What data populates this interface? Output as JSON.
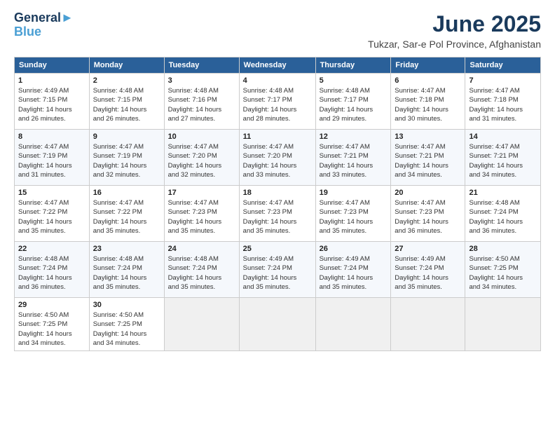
{
  "header": {
    "logo_line1": "General",
    "logo_line2": "Blue",
    "month": "June 2025",
    "location": "Tukzar, Sar-e Pol Province, Afghanistan"
  },
  "weekdays": [
    "Sunday",
    "Monday",
    "Tuesday",
    "Wednesday",
    "Thursday",
    "Friday",
    "Saturday"
  ],
  "weeks": [
    [
      {
        "day": "1",
        "info": "Sunrise: 4:49 AM\nSunset: 7:15 PM\nDaylight: 14 hours\nand 26 minutes."
      },
      {
        "day": "2",
        "info": "Sunrise: 4:48 AM\nSunset: 7:15 PM\nDaylight: 14 hours\nand 26 minutes."
      },
      {
        "day": "3",
        "info": "Sunrise: 4:48 AM\nSunset: 7:16 PM\nDaylight: 14 hours\nand 27 minutes."
      },
      {
        "day": "4",
        "info": "Sunrise: 4:48 AM\nSunset: 7:17 PM\nDaylight: 14 hours\nand 28 minutes."
      },
      {
        "day": "5",
        "info": "Sunrise: 4:48 AM\nSunset: 7:17 PM\nDaylight: 14 hours\nand 29 minutes."
      },
      {
        "day": "6",
        "info": "Sunrise: 4:47 AM\nSunset: 7:18 PM\nDaylight: 14 hours\nand 30 minutes."
      },
      {
        "day": "7",
        "info": "Sunrise: 4:47 AM\nSunset: 7:18 PM\nDaylight: 14 hours\nand 31 minutes."
      }
    ],
    [
      {
        "day": "8",
        "info": "Sunrise: 4:47 AM\nSunset: 7:19 PM\nDaylight: 14 hours\nand 31 minutes."
      },
      {
        "day": "9",
        "info": "Sunrise: 4:47 AM\nSunset: 7:19 PM\nDaylight: 14 hours\nand 32 minutes."
      },
      {
        "day": "10",
        "info": "Sunrise: 4:47 AM\nSunset: 7:20 PM\nDaylight: 14 hours\nand 32 minutes."
      },
      {
        "day": "11",
        "info": "Sunrise: 4:47 AM\nSunset: 7:20 PM\nDaylight: 14 hours\nand 33 minutes."
      },
      {
        "day": "12",
        "info": "Sunrise: 4:47 AM\nSunset: 7:21 PM\nDaylight: 14 hours\nand 33 minutes."
      },
      {
        "day": "13",
        "info": "Sunrise: 4:47 AM\nSunset: 7:21 PM\nDaylight: 14 hours\nand 34 minutes."
      },
      {
        "day": "14",
        "info": "Sunrise: 4:47 AM\nSunset: 7:21 PM\nDaylight: 14 hours\nand 34 minutes."
      }
    ],
    [
      {
        "day": "15",
        "info": "Sunrise: 4:47 AM\nSunset: 7:22 PM\nDaylight: 14 hours\nand 35 minutes."
      },
      {
        "day": "16",
        "info": "Sunrise: 4:47 AM\nSunset: 7:22 PM\nDaylight: 14 hours\nand 35 minutes."
      },
      {
        "day": "17",
        "info": "Sunrise: 4:47 AM\nSunset: 7:23 PM\nDaylight: 14 hours\nand 35 minutes."
      },
      {
        "day": "18",
        "info": "Sunrise: 4:47 AM\nSunset: 7:23 PM\nDaylight: 14 hours\nand 35 minutes."
      },
      {
        "day": "19",
        "info": "Sunrise: 4:47 AM\nSunset: 7:23 PM\nDaylight: 14 hours\nand 35 minutes."
      },
      {
        "day": "20",
        "info": "Sunrise: 4:47 AM\nSunset: 7:23 PM\nDaylight: 14 hours\nand 36 minutes."
      },
      {
        "day": "21",
        "info": "Sunrise: 4:48 AM\nSunset: 7:24 PM\nDaylight: 14 hours\nand 36 minutes."
      }
    ],
    [
      {
        "day": "22",
        "info": "Sunrise: 4:48 AM\nSunset: 7:24 PM\nDaylight: 14 hours\nand 36 minutes."
      },
      {
        "day": "23",
        "info": "Sunrise: 4:48 AM\nSunset: 7:24 PM\nDaylight: 14 hours\nand 35 minutes."
      },
      {
        "day": "24",
        "info": "Sunrise: 4:48 AM\nSunset: 7:24 PM\nDaylight: 14 hours\nand 35 minutes."
      },
      {
        "day": "25",
        "info": "Sunrise: 4:49 AM\nSunset: 7:24 PM\nDaylight: 14 hours\nand 35 minutes."
      },
      {
        "day": "26",
        "info": "Sunrise: 4:49 AM\nSunset: 7:24 PM\nDaylight: 14 hours\nand 35 minutes."
      },
      {
        "day": "27",
        "info": "Sunrise: 4:49 AM\nSunset: 7:24 PM\nDaylight: 14 hours\nand 35 minutes."
      },
      {
        "day": "28",
        "info": "Sunrise: 4:50 AM\nSunset: 7:25 PM\nDaylight: 14 hours\nand 34 minutes."
      }
    ],
    [
      {
        "day": "29",
        "info": "Sunrise: 4:50 AM\nSunset: 7:25 PM\nDaylight: 14 hours\nand 34 minutes."
      },
      {
        "day": "30",
        "info": "Sunrise: 4:50 AM\nSunset: 7:25 PM\nDaylight: 14 hours\nand 34 minutes."
      },
      {
        "day": "",
        "info": ""
      },
      {
        "day": "",
        "info": ""
      },
      {
        "day": "",
        "info": ""
      },
      {
        "day": "",
        "info": ""
      },
      {
        "day": "",
        "info": ""
      }
    ]
  ]
}
